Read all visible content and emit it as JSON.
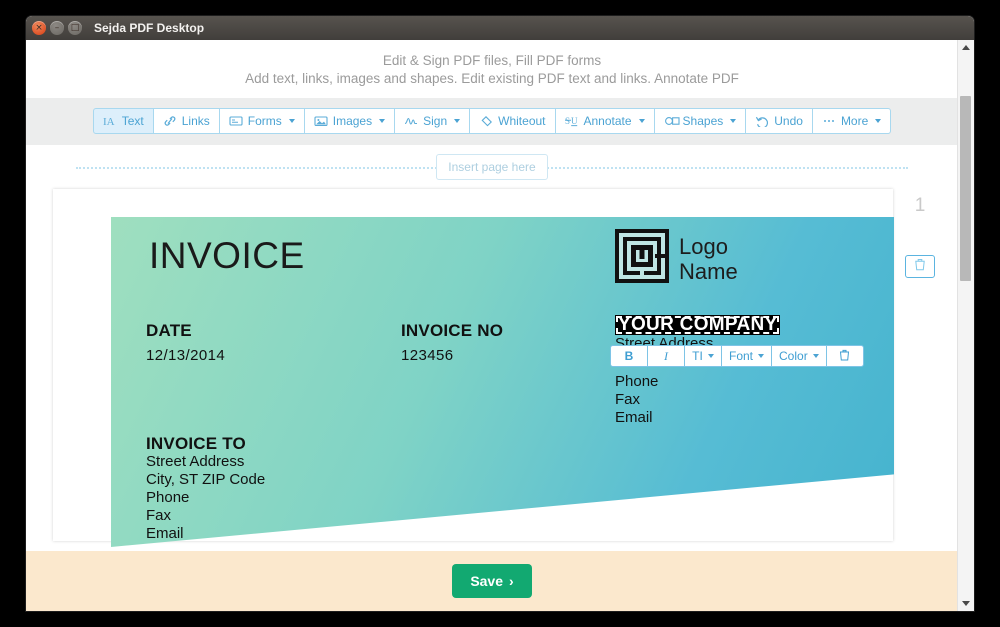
{
  "window": {
    "title": "Sejda PDF Desktop",
    "controls": {
      "close": "×",
      "minimize": "–",
      "maximize": "□"
    }
  },
  "promo": {
    "line1": "Edit & Sign PDF files, Fill PDF forms",
    "line2": "Add text, links, images and shapes. Edit existing PDF text and links. Annotate PDF"
  },
  "toolbar": {
    "items": [
      {
        "label": "Text",
        "icon": "text-cursor-icon",
        "caret": false,
        "active": true
      },
      {
        "label": "Links",
        "icon": "link-icon",
        "caret": false,
        "active": false
      },
      {
        "label": "Forms",
        "icon": "form-icon",
        "caret": true,
        "active": false
      },
      {
        "label": "Images",
        "icon": "image-icon",
        "caret": true,
        "active": false
      },
      {
        "label": "Sign",
        "icon": "signature-icon",
        "caret": true,
        "active": false
      },
      {
        "label": "Whiteout",
        "icon": "eraser-icon",
        "caret": false,
        "active": false
      },
      {
        "label": "Annotate",
        "icon": "strikethrough-underline-icon",
        "caret": true,
        "active": false
      },
      {
        "label": "Shapes",
        "icon": "shapes-icon",
        "caret": true,
        "active": false
      },
      {
        "label": "Undo",
        "icon": "undo-icon",
        "caret": false,
        "active": false
      },
      {
        "label": "More",
        "icon": "ellipsis-icon",
        "caret": true,
        "active": false
      }
    ]
  },
  "insert_page": {
    "label": "Insert page here"
  },
  "page_rail": {
    "page_number": "1",
    "delete_icon": "trash-icon"
  },
  "format_toolbar": {
    "bold": "B",
    "italic": "I",
    "size": "TI",
    "font": "Font",
    "color": "Color",
    "delete_icon": "trash-icon"
  },
  "document": {
    "title": "INVOICE",
    "logo": {
      "icon": "maze-square-logo-icon",
      "line1": "Logo",
      "line2": "Name"
    },
    "date": {
      "label": "DATE",
      "value": "12/13/2014"
    },
    "invoice_no": {
      "label": "INVOICE NO",
      "value": "123456"
    },
    "invoice_to": {
      "label": "INVOICE TO",
      "lines": [
        "Street Address",
        "City, ST ZIP Code",
        "Phone",
        "Fax",
        "Email"
      ]
    },
    "company": {
      "selected_text": "YOUR COMPANY",
      "lines": [
        "Street Address",
        "Phone",
        "Fax",
        "Email"
      ]
    },
    "colors": {
      "gradient_start": "#9fdfbf",
      "gradient_end": "#45b3ce"
    }
  },
  "bottom_bar": {
    "save_label": "Save",
    "save_chevron": "›",
    "color": "#fbe8cd"
  }
}
